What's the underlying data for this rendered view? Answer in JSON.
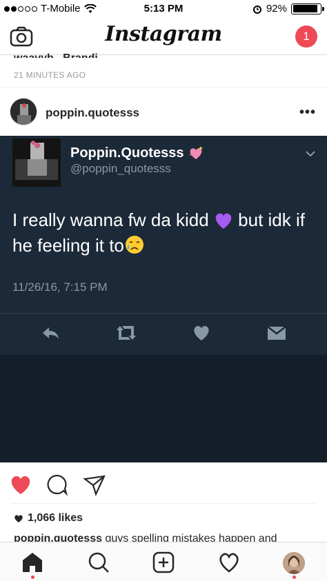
{
  "status_bar": {
    "carrier": "T-Mobile",
    "time": "5:13 PM",
    "battery": "92%",
    "battery_level": 0.92
  },
  "header": {
    "logo": "Instagram",
    "notification_count": "1"
  },
  "previous_post": {
    "caption_fragment": "waavyb_ Brandi",
    "time": "21 MINUTES AGO"
  },
  "post": {
    "username": "poppin.quotesss",
    "more_label": "•••",
    "tweet": {
      "display_name": "Poppin.Quotesss",
      "handle": "@poppin_quotesss",
      "text_part1": "I really wanna fw da kidd ",
      "text_part2": " but idk if he feeling it to",
      "date": "11/26/16, 7:15 PM"
    },
    "likes": "1,066 likes",
    "caption_user": "poppin.quotesss",
    "caption_text": " guys spelling mistakes happen and"
  },
  "colors": {
    "like_red": "#ed4956",
    "tweet_bg": "#1c2938",
    "tweet_muted": "#8899a6"
  },
  "icons": {
    "camera": "camera-icon",
    "home": "home-icon",
    "search": "search-icon",
    "add": "add-post-icon",
    "activity": "heart-outline-icon"
  }
}
